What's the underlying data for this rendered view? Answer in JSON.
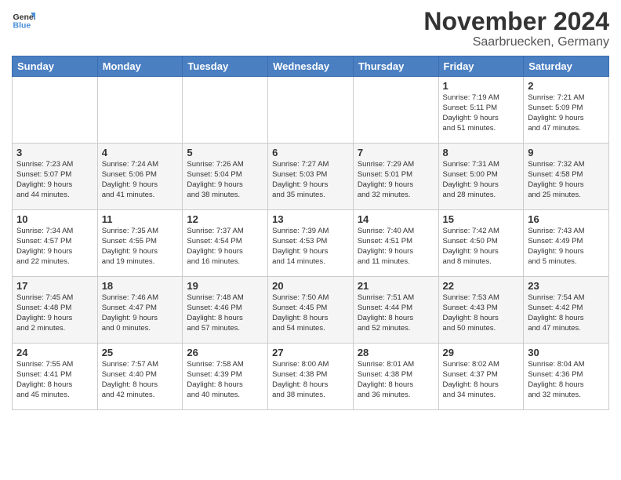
{
  "header": {
    "logo_general": "General",
    "logo_blue": "Blue",
    "month_title": "November 2024",
    "subtitle": "Saarbruecken, Germany"
  },
  "weekdays": [
    "Sunday",
    "Monday",
    "Tuesday",
    "Wednesday",
    "Thursday",
    "Friday",
    "Saturday"
  ],
  "weeks": [
    [
      {
        "day": "",
        "info": ""
      },
      {
        "day": "",
        "info": ""
      },
      {
        "day": "",
        "info": ""
      },
      {
        "day": "",
        "info": ""
      },
      {
        "day": "",
        "info": ""
      },
      {
        "day": "1",
        "info": "Sunrise: 7:19 AM\nSunset: 5:11 PM\nDaylight: 9 hours\nand 51 minutes."
      },
      {
        "day": "2",
        "info": "Sunrise: 7:21 AM\nSunset: 5:09 PM\nDaylight: 9 hours\nand 47 minutes."
      }
    ],
    [
      {
        "day": "3",
        "info": "Sunrise: 7:23 AM\nSunset: 5:07 PM\nDaylight: 9 hours\nand 44 minutes."
      },
      {
        "day": "4",
        "info": "Sunrise: 7:24 AM\nSunset: 5:06 PM\nDaylight: 9 hours\nand 41 minutes."
      },
      {
        "day": "5",
        "info": "Sunrise: 7:26 AM\nSunset: 5:04 PM\nDaylight: 9 hours\nand 38 minutes."
      },
      {
        "day": "6",
        "info": "Sunrise: 7:27 AM\nSunset: 5:03 PM\nDaylight: 9 hours\nand 35 minutes."
      },
      {
        "day": "7",
        "info": "Sunrise: 7:29 AM\nSunset: 5:01 PM\nDaylight: 9 hours\nand 32 minutes."
      },
      {
        "day": "8",
        "info": "Sunrise: 7:31 AM\nSunset: 5:00 PM\nDaylight: 9 hours\nand 28 minutes."
      },
      {
        "day": "9",
        "info": "Sunrise: 7:32 AM\nSunset: 4:58 PM\nDaylight: 9 hours\nand 25 minutes."
      }
    ],
    [
      {
        "day": "10",
        "info": "Sunrise: 7:34 AM\nSunset: 4:57 PM\nDaylight: 9 hours\nand 22 minutes."
      },
      {
        "day": "11",
        "info": "Sunrise: 7:35 AM\nSunset: 4:55 PM\nDaylight: 9 hours\nand 19 minutes."
      },
      {
        "day": "12",
        "info": "Sunrise: 7:37 AM\nSunset: 4:54 PM\nDaylight: 9 hours\nand 16 minutes."
      },
      {
        "day": "13",
        "info": "Sunrise: 7:39 AM\nSunset: 4:53 PM\nDaylight: 9 hours\nand 14 minutes."
      },
      {
        "day": "14",
        "info": "Sunrise: 7:40 AM\nSunset: 4:51 PM\nDaylight: 9 hours\nand 11 minutes."
      },
      {
        "day": "15",
        "info": "Sunrise: 7:42 AM\nSunset: 4:50 PM\nDaylight: 9 hours\nand 8 minutes."
      },
      {
        "day": "16",
        "info": "Sunrise: 7:43 AM\nSunset: 4:49 PM\nDaylight: 9 hours\nand 5 minutes."
      }
    ],
    [
      {
        "day": "17",
        "info": "Sunrise: 7:45 AM\nSunset: 4:48 PM\nDaylight: 9 hours\nand 2 minutes."
      },
      {
        "day": "18",
        "info": "Sunrise: 7:46 AM\nSunset: 4:47 PM\nDaylight: 9 hours\nand 0 minutes."
      },
      {
        "day": "19",
        "info": "Sunrise: 7:48 AM\nSunset: 4:46 PM\nDaylight: 8 hours\nand 57 minutes."
      },
      {
        "day": "20",
        "info": "Sunrise: 7:50 AM\nSunset: 4:45 PM\nDaylight: 8 hours\nand 54 minutes."
      },
      {
        "day": "21",
        "info": "Sunrise: 7:51 AM\nSunset: 4:44 PM\nDaylight: 8 hours\nand 52 minutes."
      },
      {
        "day": "22",
        "info": "Sunrise: 7:53 AM\nSunset: 4:43 PM\nDaylight: 8 hours\nand 50 minutes."
      },
      {
        "day": "23",
        "info": "Sunrise: 7:54 AM\nSunset: 4:42 PM\nDaylight: 8 hours\nand 47 minutes."
      }
    ],
    [
      {
        "day": "24",
        "info": "Sunrise: 7:55 AM\nSunset: 4:41 PM\nDaylight: 8 hours\nand 45 minutes."
      },
      {
        "day": "25",
        "info": "Sunrise: 7:57 AM\nSunset: 4:40 PM\nDaylight: 8 hours\nand 42 minutes."
      },
      {
        "day": "26",
        "info": "Sunrise: 7:58 AM\nSunset: 4:39 PM\nDaylight: 8 hours\nand 40 minutes."
      },
      {
        "day": "27",
        "info": "Sunrise: 8:00 AM\nSunset: 4:38 PM\nDaylight: 8 hours\nand 38 minutes."
      },
      {
        "day": "28",
        "info": "Sunrise: 8:01 AM\nSunset: 4:38 PM\nDaylight: 8 hours\nand 36 minutes."
      },
      {
        "day": "29",
        "info": "Sunrise: 8:02 AM\nSunset: 4:37 PM\nDaylight: 8 hours\nand 34 minutes."
      },
      {
        "day": "30",
        "info": "Sunrise: 8:04 AM\nSunset: 4:36 PM\nDaylight: 8 hours\nand 32 minutes."
      }
    ]
  ]
}
